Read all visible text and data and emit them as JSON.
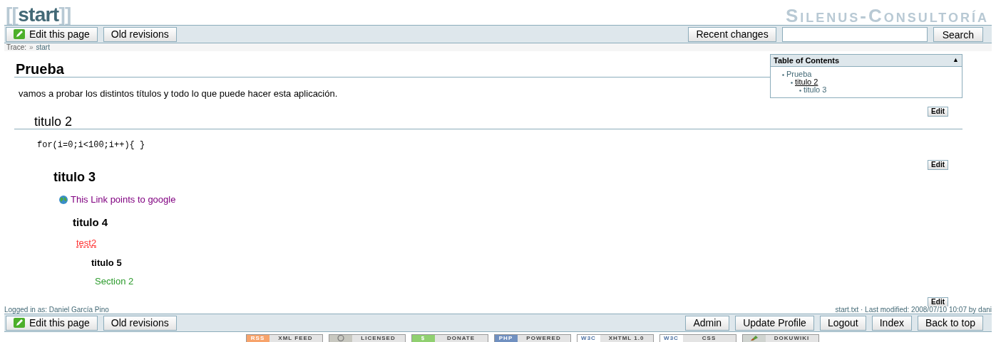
{
  "header": {
    "title_prefix": "[[",
    "title": "start",
    "title_suffix": "]]",
    "site_name": "Silenus-Consultoría"
  },
  "top_bar": {
    "left_buttons": [
      {
        "label": "Edit this page",
        "kind": "edit"
      },
      {
        "label": "Old revisions",
        "kind": "plain"
      }
    ],
    "right_buttons": [
      {
        "label": "Recent changes",
        "kind": "plain"
      }
    ],
    "search_button": "Search"
  },
  "trace": {
    "label": "Trace:",
    "separator": "»",
    "pages": [
      "start"
    ]
  },
  "toc": {
    "title": "Table of Contents",
    "toggle": "▲",
    "items": [
      {
        "label": "Prueba",
        "current": false,
        "children": [
          {
            "label": "titulo 2",
            "current": true,
            "children": [
              {
                "label": "titulo 3",
                "current": false
              }
            ]
          }
        ]
      }
    ]
  },
  "sections": [
    {
      "heading": "Prueba",
      "content": [
        {
          "kind": "text",
          "text": "vamos a probar los distintos títulos y todo lo que puede hacer esta aplicación."
        }
      ],
      "edit": "Edit",
      "children": [
        {
          "heading": "titulo 2",
          "content": [
            {
              "kind": "code",
              "text": "for(i=0;i<100;i++){ }"
            }
          ],
          "edit": "Edit",
          "children": [
            {
              "heading": "titulo 3",
              "content": [
                {
                  "kind": "external",
                  "text": "This Link points to google"
                }
              ],
              "children": [
                {
                  "heading": "titulo 4",
                  "content": [
                    {
                      "kind": "missing",
                      "text": "test2"
                    }
                  ],
                  "children": [
                    {
                      "heading": "titulo 5",
                      "content": [
                        {
                          "kind": "internal",
                          "text": "Section 2"
                        }
                      ],
                      "edit": "Edit"
                    }
                  ]
                }
              ]
            }
          ]
        }
      ]
    }
  ],
  "footer": {
    "user": "Logged in as: Daniel García Pino",
    "doc_info": "start.txt · Last modified: 2008/07/10 10:07 by dani"
  },
  "bottom_bar": {
    "left_buttons": [
      {
        "label": "Edit this page",
        "kind": "edit"
      },
      {
        "label": "Old revisions",
        "kind": "plain"
      }
    ],
    "right_buttons": [
      {
        "label": "Admin",
        "kind": "plain"
      },
      {
        "label": "Update Profile",
        "kind": "plain"
      },
      {
        "label": "Logout",
        "kind": "plain"
      },
      {
        "label": "Index",
        "kind": "plain"
      },
      {
        "label": "Back to top",
        "kind": "plain"
      }
    ]
  },
  "badges": [
    {
      "mark": "RSS",
      "label": "XML FEED",
      "color": "#f7a36b"
    },
    {
      "label": "LICENSED",
      "color": "#c8c8c0"
    },
    {
      "mark": "$",
      "label": "DONATE",
      "color": "#90d070"
    },
    {
      "mark": "PHP",
      "label": "POWERED",
      "color": "#7090c0"
    },
    {
      "mark": "W3C",
      "label": "XHTML 1.0",
      "color": "#ffffff"
    },
    {
      "mark": "W3C",
      "label": "CSS",
      "color": "#ffffff"
    },
    {
      "label": "DOKUWIKI",
      "color": "#d0d4d0"
    }
  ]
}
